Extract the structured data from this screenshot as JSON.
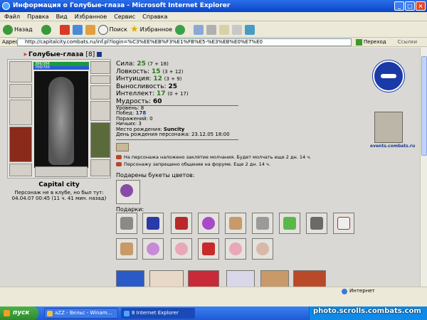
{
  "window": {
    "title": "Информация о Голубые-глаза - Microsoft Internet Explorer"
  },
  "menu": [
    "Файл",
    "Правка",
    "Вид",
    "Избранное",
    "Сервис",
    "Справка"
  ],
  "toolbar": {
    "back": "Назад",
    "search": "Поиск",
    "favorites": "Избранное"
  },
  "address": {
    "label": "Адрес:",
    "url": "http://capitalcity.combats.ru/inf.pl?login=%C3%EE%EB%F3%E1%FB%E5-%E3%EB%E0%E7%E0",
    "go": "Переход",
    "links": "Ссылки"
  },
  "character": {
    "name": "Голубые-глаза",
    "level": "[8]",
    "hp": "386/386",
    "mp": "700/700",
    "city": "Capital city",
    "club_info": "Персонаж не в клубе, но был тут: 04.04.07 00:45 (11 ч. 41 мин. назад)"
  },
  "stats": [
    {
      "label": "Сила:",
      "value": "25",
      "mod": "(7 + 18)"
    },
    {
      "label": "Ловкость:",
      "value": "15",
      "mod": "(3 + 12)"
    },
    {
      "label": "Интуиция:",
      "value": "12",
      "mod": "(3 + 9)"
    },
    {
      "label": "Выносливость:",
      "value": "25",
      "mod": ""
    },
    {
      "label": "Интеллект:",
      "value": "17",
      "mod": "(0 + 17)"
    },
    {
      "label": "Мудрость:",
      "value": "60",
      "mod": ""
    }
  ],
  "info": [
    {
      "label": "Уровень:",
      "value": "8"
    },
    {
      "label": "Побед:",
      "value": "178"
    },
    {
      "label": "Поражений:",
      "value": "0"
    },
    {
      "label": "Ничьих:",
      "value": "3"
    },
    {
      "label": "Место рождения:",
      "value": "Suncity"
    },
    {
      "label": "День рождения персонажа:",
      "value": "23.12.05 18:00"
    }
  ],
  "notices": [
    "На персонажа наложено заклятие молчания. Будет молчать еще 2 дн. 14 ч.",
    "Персонажу запрещено общение на форуме. Еще 2 дн. 14 ч."
  ],
  "sections": {
    "flowers": "Подарены букеты цветов:",
    "gifts": "Подарки:"
  },
  "emblem": {
    "caption": "events.combats.ru"
  },
  "statusbar": {
    "zone": "Интернет"
  },
  "taskbar": {
    "start": "пуск",
    "tasks": [
      "aZZ - Вельс - Winam...",
      "8 Internet Explorer"
    ],
    "watermark": "photo.scrolls.combats.com"
  }
}
